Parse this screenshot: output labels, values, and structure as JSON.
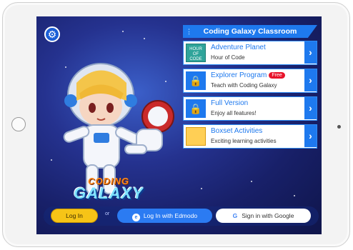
{
  "settings": {
    "icon": "gear-icon"
  },
  "logo": {
    "line1": "CODING",
    "line2": "GALAXY"
  },
  "panel": {
    "title": "Coding Galaxy Classroom",
    "items": [
      {
        "title": "Adventure Planet",
        "subtitle": "Hour of Code",
        "thumb_text": "HOUR OF CODE",
        "badge": ""
      },
      {
        "title": "Explorer Program",
        "subtitle": "Teach with Coding Galaxy",
        "badge": "Free"
      },
      {
        "title": "Full Version",
        "subtitle": "Enjoy all features!",
        "badge": ""
      },
      {
        "title": "Boxset Activities",
        "subtitle": "Exciting learning activities",
        "badge": ""
      }
    ]
  },
  "auth": {
    "login": "Log In",
    "or": "or",
    "edmodo": "Log In with Edmodo",
    "google": "Sign in with Google"
  },
  "colors": {
    "accent": "#1e79ee",
    "login_yellow": "#f6c417",
    "badge_red": "#e8132a"
  }
}
